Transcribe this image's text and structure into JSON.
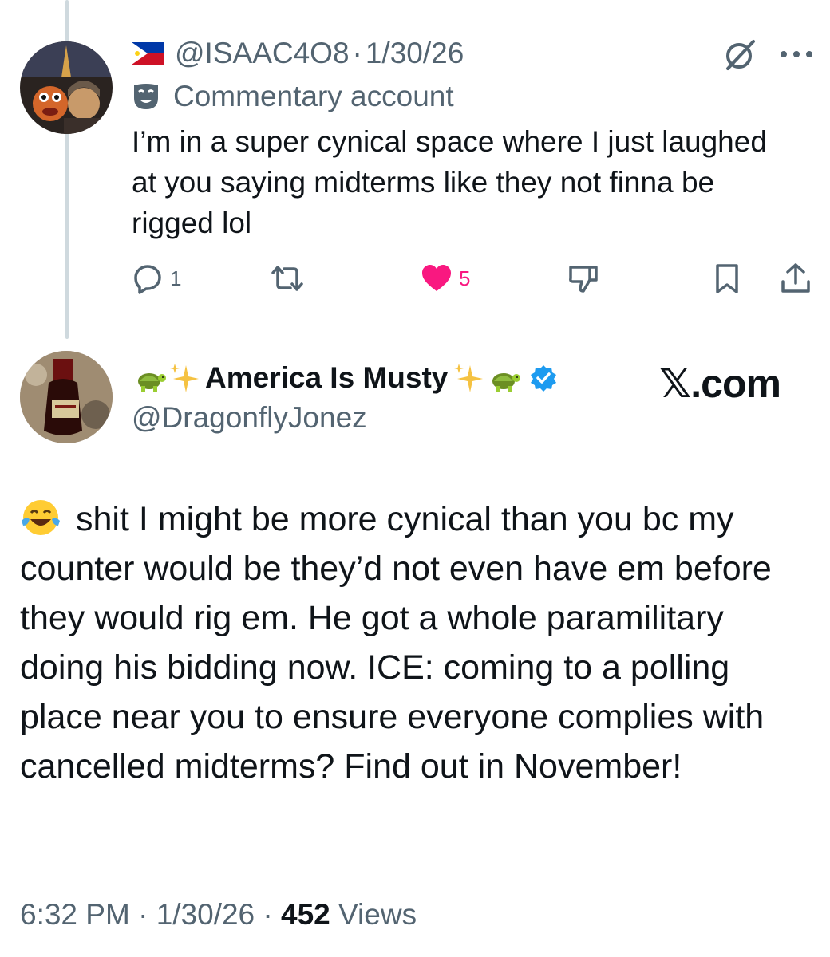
{
  "reply": {
    "handle": "@ISAAC4O8",
    "dot": "·",
    "date": "1/30/26",
    "account_label": "Commentary account",
    "text": "I’m in a super cynical space where I just laughed at you saying midterms like they not finna be rigged lol",
    "reply_count": "1",
    "like_count": "5"
  },
  "post": {
    "name": "America Is Musty",
    "handle": "@DragonflyJonez",
    "watermark": "𝕏.com",
    "text": "shit I might be more cynical than you bc my counter would be they’d not even have em before they would rig em. He got a whole paramilitary doing his bidding now. ICE: coming to a polling place near you to ensure everyone complies with cancelled midterms? Find out in November!",
    "time": "6:32 PM",
    "date": "1/30/26",
    "views_count": "452",
    "views_label": "Views",
    "sep": "·"
  },
  "colors": {
    "secondary": "#536471",
    "like": "#f91880",
    "verified": "#1d9bf0",
    "thread_line": "#cfd9de"
  },
  "icons": [
    "philippines-flag-icon",
    "mask-icon",
    "grok-icon",
    "more-icon",
    "reply-icon",
    "repost-icon",
    "heart-icon",
    "dislike-icon",
    "bookmark-icon",
    "share-icon",
    "turtle-emoji",
    "sparkles-emoji",
    "verified-badge-icon",
    "laughing-tears-emoji"
  ]
}
